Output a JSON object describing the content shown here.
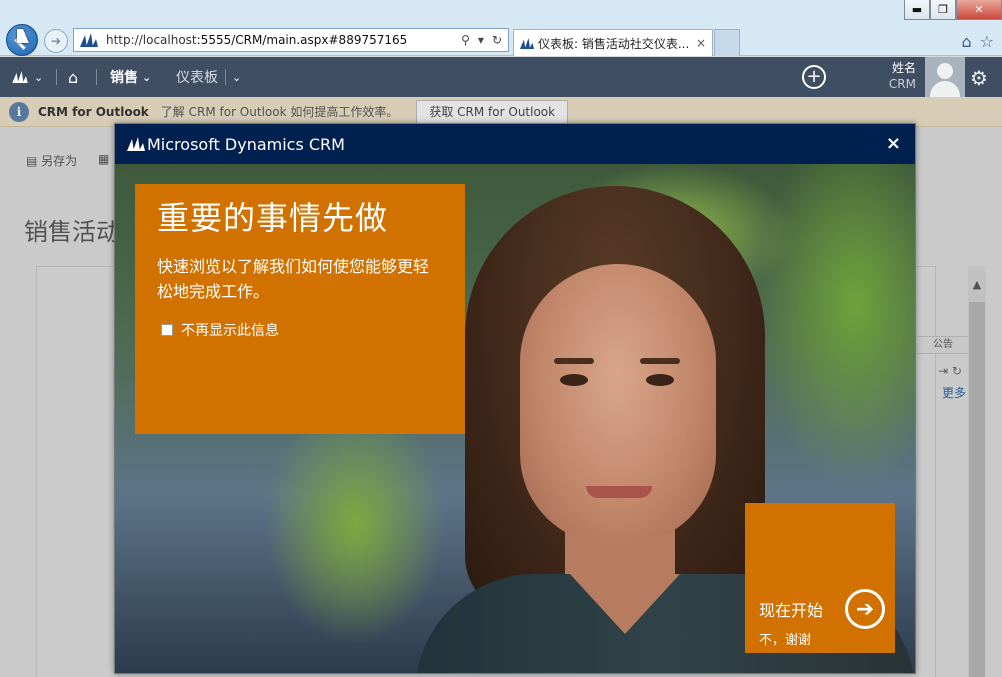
{
  "browser": {
    "url_prefix": "http://localhost",
    "url_rest": ":5555/CRM/main.aspx#889757165",
    "tab_title": "仪表板: 销售活动社交仪表...",
    "tab_close": "×",
    "win_min": "▬",
    "win_restore": "❐",
    "win_close": "✕"
  },
  "nav": {
    "area": "销售",
    "page": "仪表板",
    "user_name": "姓名",
    "user_sub": "CRM"
  },
  "infobar": {
    "title": "CRM for Outlook",
    "text": "了解 CRM for Outlook 如何提高工作效率。",
    "button": "获取 CRM for Outlook"
  },
  "page": {
    "cmd_save_as": "另存为",
    "title": "销售活动",
    "panel_head": "公告",
    "more_link": "更多"
  },
  "modal": {
    "header": "Microsoft Dynamics CRM",
    "close": "×",
    "panel_title": "重要的事情先做",
    "panel_desc": "快速浏览以了解我们如何使您能够更轻松地完成工作。",
    "checkbox_label": "不再显示此信息",
    "start_label": "现在开始",
    "no_thanks": "不，谢谢",
    "accent_color": "#D17100",
    "header_color": "#002050"
  }
}
